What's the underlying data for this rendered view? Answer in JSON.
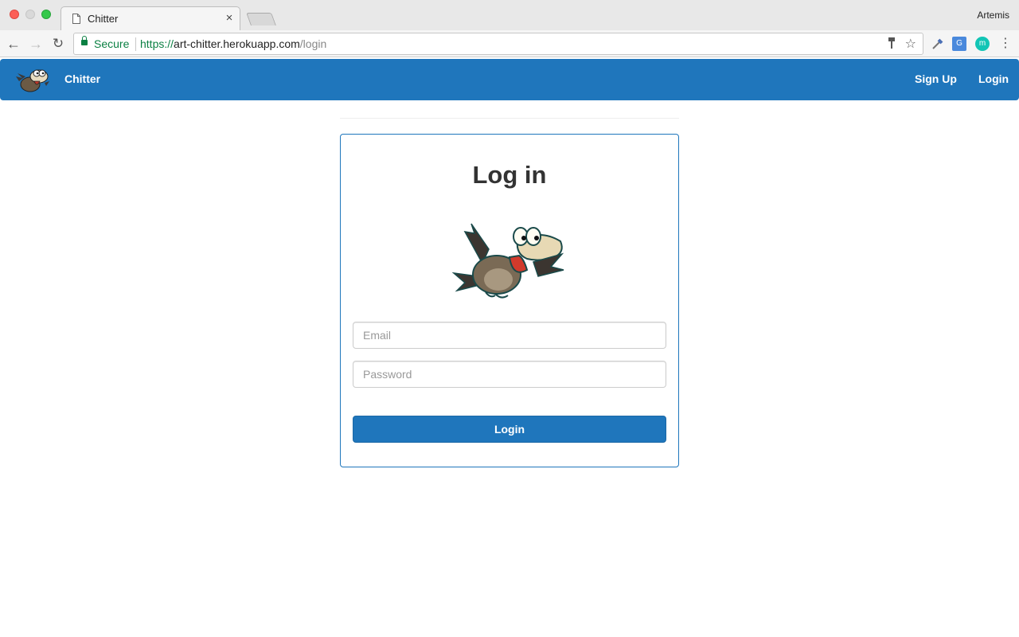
{
  "browser": {
    "tab_title": "Chitter",
    "tab_close": "×",
    "profile_name": "Artemis",
    "secure_label": "Secure",
    "url_scheme": "https://",
    "url_host": "art-chitter.herokuapp.com",
    "url_path": "/login",
    "icons": {
      "back": "back-arrow-icon",
      "forward": "forward-arrow-icon",
      "reload": "reload-icon",
      "bookmark": "star-icon",
      "paint": "paint-roller-icon",
      "picker": "eyedropper-icon",
      "translate": "google-translate-icon",
      "extension_m": "m-extension-icon",
      "menu": "kebab-menu-icon"
    }
  },
  "navbar": {
    "brand": "Chitter",
    "links": {
      "signup": "Sign Up",
      "login": "Login"
    },
    "color": "#1f76bc"
  },
  "login_form": {
    "heading": "Log in",
    "email_placeholder": "Email",
    "password_placeholder": "Password",
    "submit_label": "Login",
    "accent_color": "#1f76bc"
  }
}
